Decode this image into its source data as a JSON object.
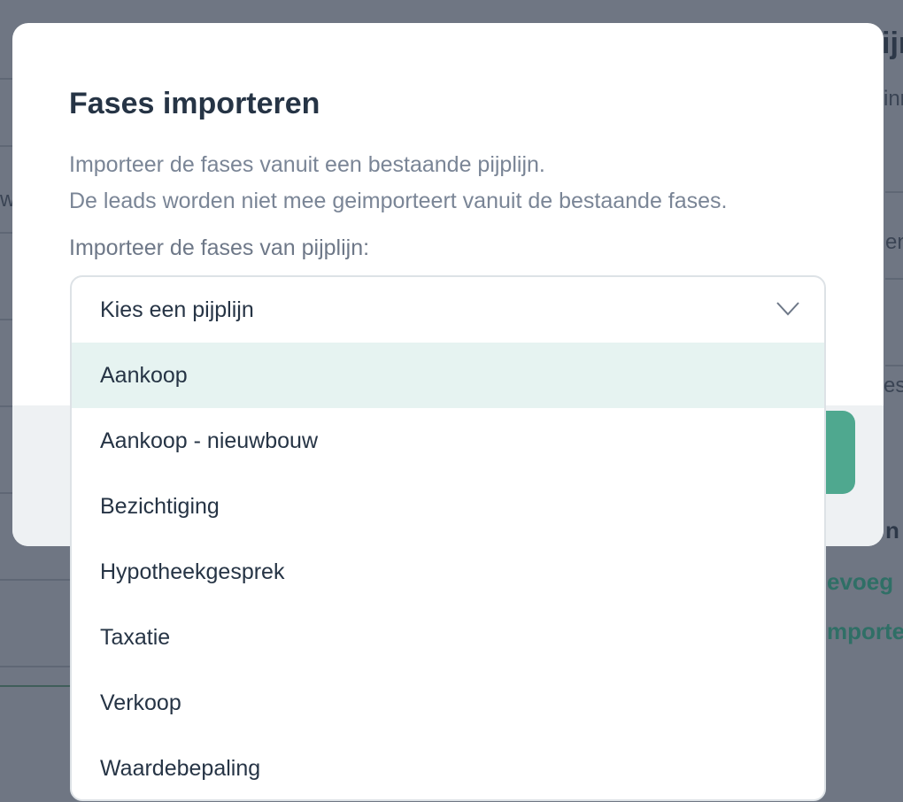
{
  "background": {
    "fragments": [
      "ijn",
      "inn",
      "w",
      "en",
      "es",
      "n",
      "evoeg",
      "mporte"
    ]
  },
  "modal": {
    "title": "Fases importeren",
    "description_line1": "Importeer de fases vanuit een bestaande pijplijn.",
    "description_line2": "De leads worden niet mee geimporteert vanuit de bestaande fases.",
    "field_label": "Importeer de fases van pijplijn:",
    "select": {
      "placeholder": "Kies een pijplijn",
      "options": [
        "Aankoop",
        "Aankoop - nieuwbouw",
        "Bezichtiging",
        "Hypotheekgesprek",
        "Taxatie",
        "Verkoop",
        "Waardebepaling"
      ],
      "highlighted_index": 0
    }
  },
  "colors": {
    "overlay": "#6f7683",
    "accent": "#4fa88f",
    "highlight": "#e6f3f1",
    "title": "#263445",
    "muted": "#7a8596"
  },
  "icons": {
    "select_chevron": "chevron-down-icon"
  }
}
